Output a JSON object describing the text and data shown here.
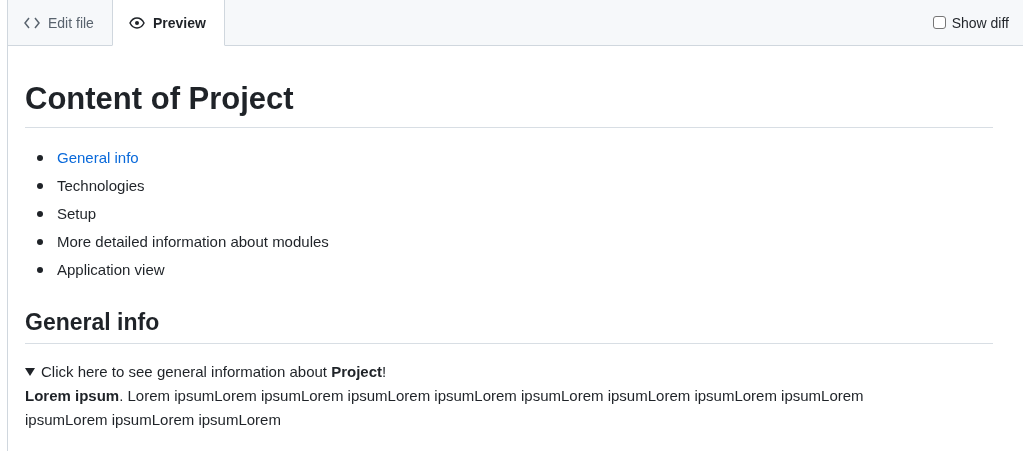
{
  "tabs": [
    {
      "label": "Edit file",
      "kind": "code",
      "selected": false
    },
    {
      "label": "Preview",
      "kind": "eye",
      "selected": true
    }
  ],
  "show_diff": {
    "label": "Show diff",
    "checked": false
  },
  "document": {
    "title": "Content of Project",
    "toc": [
      {
        "text": "General info",
        "link": true
      },
      {
        "text": "Technologies",
        "link": false
      },
      {
        "text": "Setup",
        "link": false
      },
      {
        "text": "More detailed information about modules",
        "link": false
      },
      {
        "text": "Application view",
        "link": false
      }
    ],
    "section_title": "General info",
    "details": {
      "summary": "Click here to see general information about **Project**!",
      "expanded": true,
      "body": "**Lorem ipsum**. Lorem ipsumLorem ipsumLorem ipsumLorem ipsumLorem ipsumLorem ipsumLorem ipsumLorem ipsumLorem ipsumLorem ipsumLorem ipsumLorem"
    }
  }
}
